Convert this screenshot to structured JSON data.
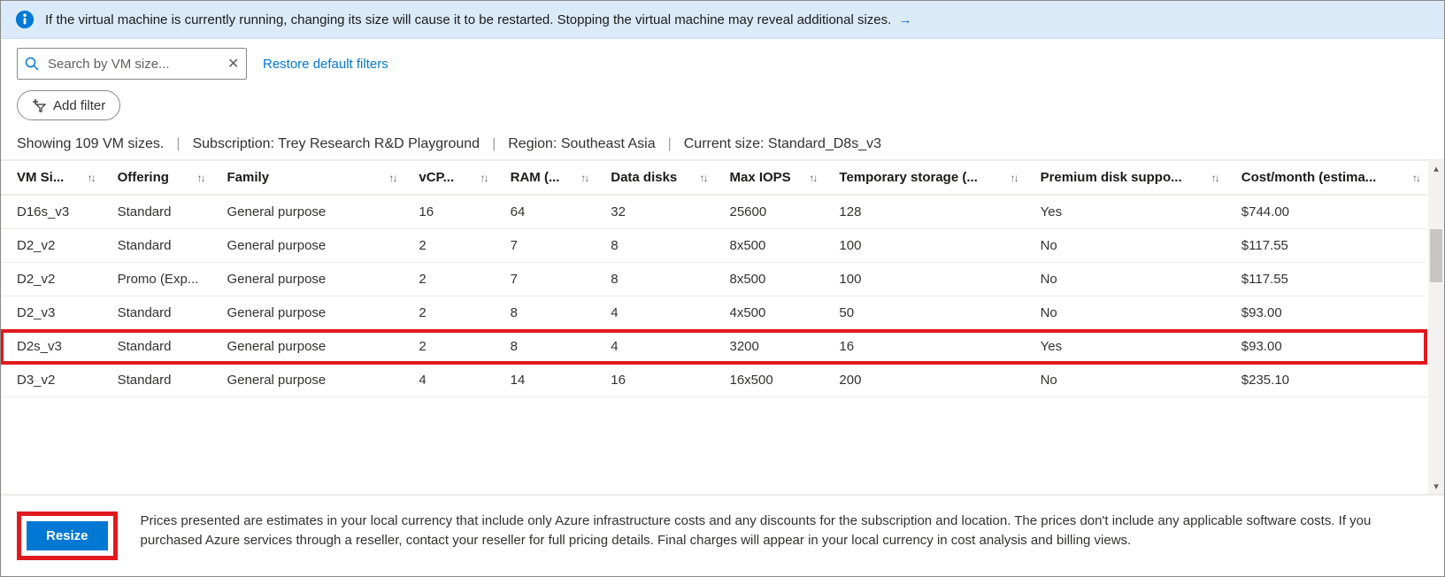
{
  "banner": {
    "text": "If the virtual machine is currently running, changing its size will cause it to be restarted. Stopping the virtual machine may reveal additional sizes."
  },
  "search": {
    "placeholder": "Search by VM size..."
  },
  "links": {
    "restore": "Restore default filters"
  },
  "buttons": {
    "add_filter": "Add filter",
    "resize": "Resize"
  },
  "status": {
    "count": "Showing 109 VM sizes.",
    "subscription_label": "Subscription:",
    "subscription_value": "Trey Research R&D Playground",
    "region_label": "Region:",
    "region_value": "Southeast Asia",
    "current_label": "Current size:",
    "current_value": "Standard_D8s_v3"
  },
  "columns": [
    "VM Si...",
    "Offering",
    "Family",
    "vCP...",
    "RAM (...",
    "Data disks",
    "Max IOPS",
    "Temporary storage (...",
    "Premium disk suppo...",
    "Cost/month (estima..."
  ],
  "rows": [
    {
      "size": "D16s_v3",
      "offering": "Standard",
      "family": "General purpose",
      "vcpu": "16",
      "ram": "64",
      "disks": "32",
      "iops": "25600",
      "temp": "128",
      "premium": "Yes",
      "cost": "$744.00",
      "highlight": false
    },
    {
      "size": "D2_v2",
      "offering": "Standard",
      "family": "General purpose",
      "vcpu": "2",
      "ram": "7",
      "disks": "8",
      "iops": "8x500",
      "temp": "100",
      "premium": "No",
      "cost": "$117.55",
      "highlight": false
    },
    {
      "size": "D2_v2",
      "offering": "Promo (Exp...",
      "family": "General purpose",
      "vcpu": "2",
      "ram": "7",
      "disks": "8",
      "iops": "8x500",
      "temp": "100",
      "premium": "No",
      "cost": "$117.55",
      "highlight": false
    },
    {
      "size": "D2_v3",
      "offering": "Standard",
      "family": "General purpose",
      "vcpu": "2",
      "ram": "8",
      "disks": "4",
      "iops": "4x500",
      "temp": "50",
      "premium": "No",
      "cost": "$93.00",
      "highlight": false
    },
    {
      "size": "D2s_v3",
      "offering": "Standard",
      "family": "General purpose",
      "vcpu": "2",
      "ram": "8",
      "disks": "4",
      "iops": "3200",
      "temp": "16",
      "premium": "Yes",
      "cost": "$93.00",
      "highlight": true
    },
    {
      "size": "D3_v2",
      "offering": "Standard",
      "family": "General purpose",
      "vcpu": "4",
      "ram": "14",
      "disks": "16",
      "iops": "16x500",
      "temp": "200",
      "premium": "No",
      "cost": "$235.10",
      "highlight": false
    }
  ],
  "footer": {
    "disclaimer": "Prices presented are estimates in your local currency that include only Azure infrastructure costs and any discounts for the subscription and location. The prices don't include any applicable software costs. If you purchased Azure services through a reseller, contact your reseller for full pricing details. Final charges will appear in your local currency in cost analysis and billing views."
  }
}
